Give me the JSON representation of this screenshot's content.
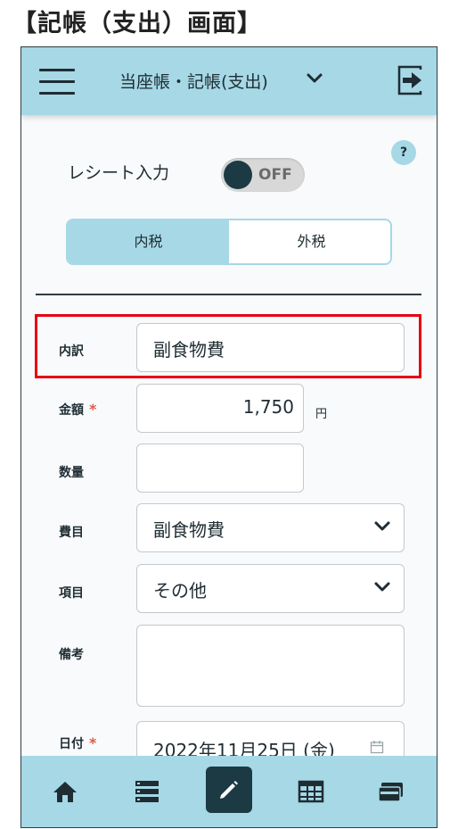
{
  "caption": "【記帳（支出）画面】",
  "header": {
    "title": "当座帳・記帳(支出)",
    "menu_icon": "hamburger-icon",
    "dropdown_icon": "chevron-down-icon",
    "exit_icon": "logout-icon"
  },
  "help": {
    "label": "?"
  },
  "receipt": {
    "label": "レシート入力",
    "toggle_label": "OFF",
    "toggle_on": false
  },
  "tax_mode": {
    "options": [
      "内税",
      "外税"
    ],
    "selected": "内税"
  },
  "form": {
    "breakdown": {
      "label": "内訳",
      "value": "副食物費"
    },
    "amount": {
      "label": "金額",
      "required_mark": "*",
      "value": "1,750",
      "unit": "円"
    },
    "quantity": {
      "label": "数量",
      "value": ""
    },
    "expense_category": {
      "label": "費目",
      "value": "副食物費"
    },
    "item": {
      "label": "項目",
      "value": "その他"
    },
    "notes": {
      "label": "備考",
      "value": ""
    },
    "date": {
      "label": "日付",
      "required_mark": "*",
      "value": "2022年11月25日 (金)"
    }
  },
  "bottom_nav": [
    "home-icon",
    "list-icon",
    "edit-icon",
    "table-icon",
    "wallet-icon"
  ],
  "colors": {
    "accent": "#a6d8e6",
    "dark": "#1c3a44",
    "highlight": "#e60012",
    "required": "#e05a4a"
  }
}
